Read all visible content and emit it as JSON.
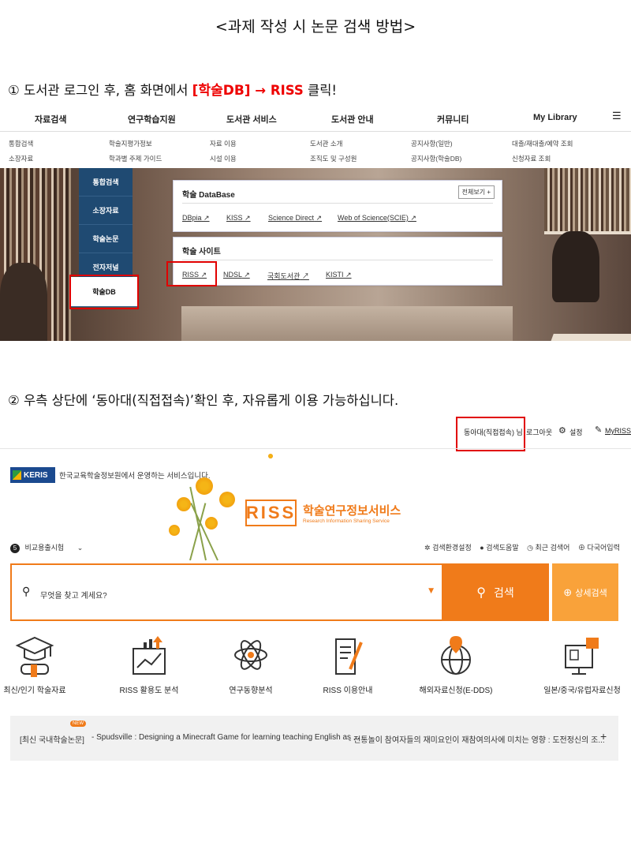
{
  "doc_title": "<과제 작성 시 논문 검색 방법>",
  "step1": {
    "num": "①",
    "text": " 도서관 로그인 후, 홈 화면에서 ",
    "highlight": "[학술DB]",
    "arrow": " → ",
    "riss": "RISS",
    "tail": " 클릭!"
  },
  "library": {
    "nav": [
      "자료검색",
      "연구학습지원",
      "도서관 서비스",
      "도서관 안내",
      "커뮤니티",
      "My Library"
    ],
    "menu_icon": "hamburger-icon",
    "sub": [
      [
        "통합검색",
        "소장자료"
      ],
      [
        "학술지평가정보",
        "학과별 주제 가이드"
      ],
      [
        "자료 이용",
        "시설 이용"
      ],
      [
        "도서관 소개",
        "조직도 및 구성원"
      ],
      [
        "공지사항(일반)",
        "공지사항(학술DB)"
      ],
      [
        "대출/재대출/예약 조회",
        "신청자료 조회"
      ]
    ],
    "side": [
      "통합검색",
      "소장자료",
      "학술논문",
      "전자저널",
      "학술DB"
    ],
    "db_panel": {
      "title": "학술 DataBase",
      "more": "전체보기 +",
      "links": [
        "DBpia",
        "KISS",
        "Science Direct",
        "Web of Science(SCIE)"
      ]
    },
    "site_panel": {
      "title": "학술 사이트",
      "links": [
        "RISS",
        "NDSL",
        "국회도서관",
        "KISTI"
      ]
    }
  },
  "step2": {
    "text": "② 우측 상단에 ‘동아대(직접접속)’확인 후, 자유롭게 이용 가능하십니다."
  },
  "riss": {
    "top": {
      "user": "동아대(직접접속) 님",
      "logout": "로그아웃",
      "settings": "설정",
      "myriss": "MyRISS"
    },
    "keris": "KERIS",
    "keris_text": "한국교육학술정보원에서 운영하는 서비스입니다.",
    "logo": "RISS",
    "name": "학술연구정보서비스",
    "name_en": "Research Information Sharing Service",
    "compare": {
      "count": "5",
      "label": "비교용출시험"
    },
    "opts": [
      "검색환경설정",
      "검색도움말",
      "최근 검색어",
      "다국어입력"
    ],
    "search_placeholder": "무엇을 찾고 계세요?",
    "search_btn": "검색",
    "adv_btn": "상세검색",
    "services": [
      "최신/인기 학술자료",
      "RISS 활용도 분석",
      "연구동향분석",
      "RISS 이용안내",
      "해외자료신청(E-DDS)",
      "일본/중국/유럽자료신청"
    ],
    "ticker": {
      "label": "[최신 국내학술논문]",
      "badge": "NEW",
      "item1": "- Spudsville : Designing a Minecraft Game for learning teaching English as ...",
      "item2": "- 전통놀이 참여자들의 재미요인이 재참여의사에 미치는 영향 : 도전정신의 조...",
      "plus": "+"
    }
  },
  "colors": {
    "accent": "#f07b1a",
    "highlight": "#e10000",
    "library_blue": "#1f4a72"
  }
}
